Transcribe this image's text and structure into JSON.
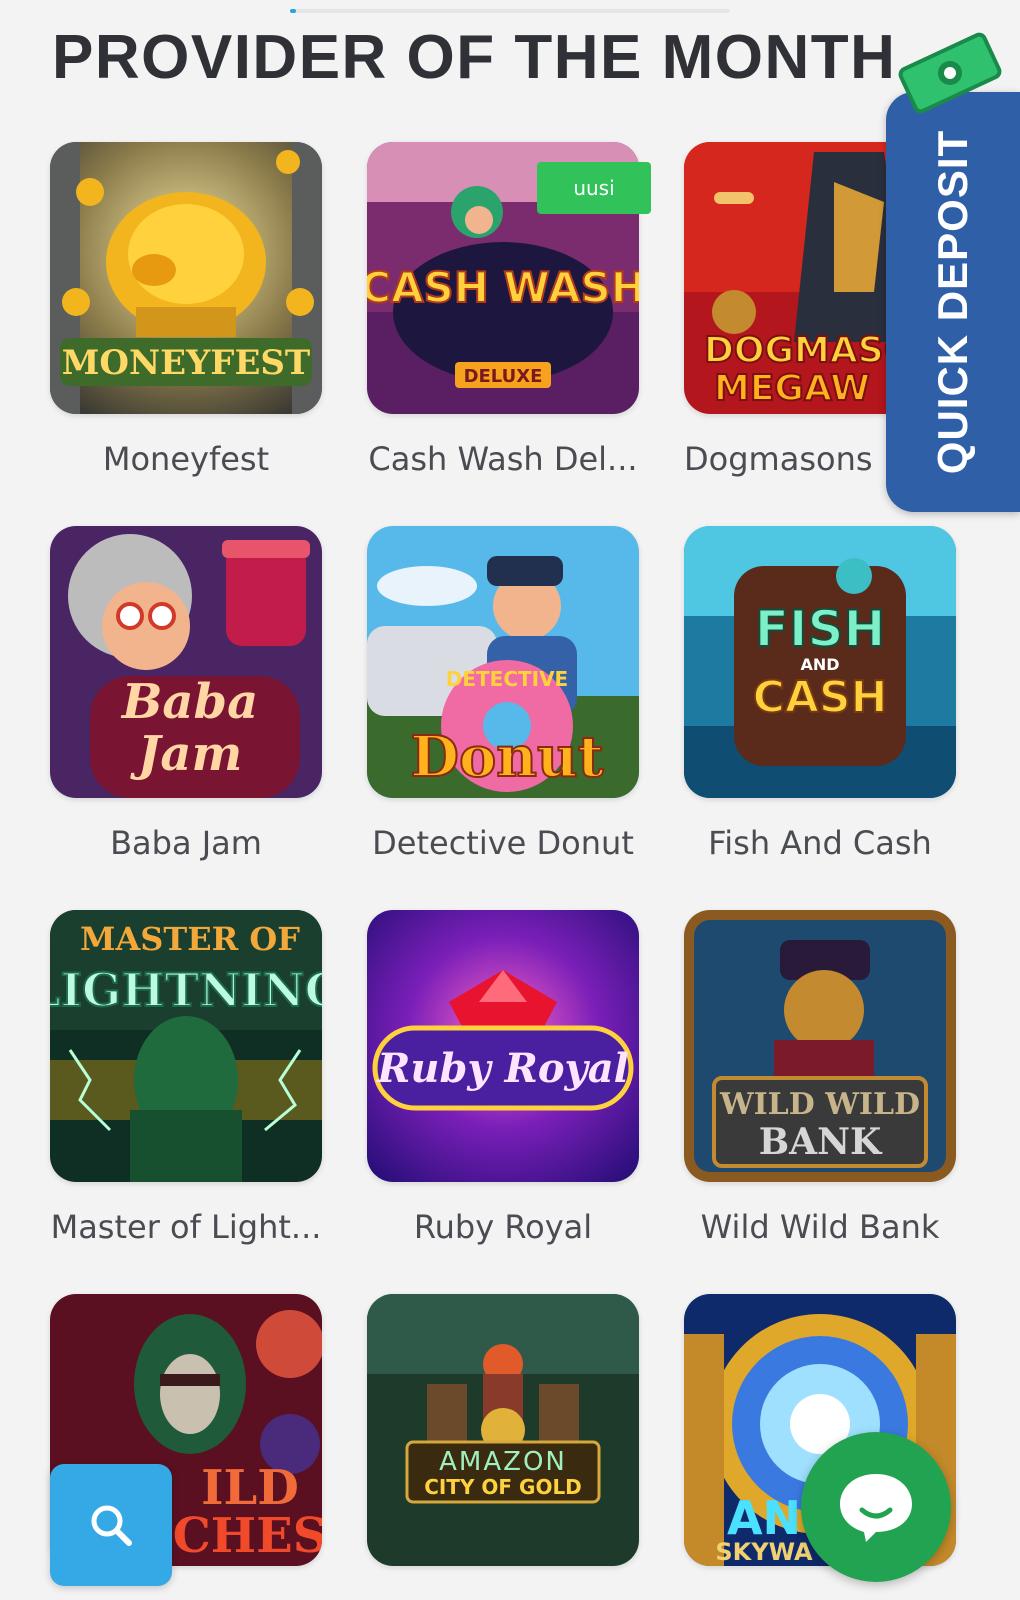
{
  "page": {
    "title": "PROVIDER OF THE MONTH"
  },
  "games": [
    {
      "name": "Moneyfest",
      "art_text": "MONEYFEST",
      "badge": ""
    },
    {
      "name": "Cash Wash Del...",
      "art_text": "CASH WASH",
      "art_sub": "DELUXE",
      "badge": "uusi"
    },
    {
      "name": "Dogmasons",
      "art_text": "DOGMASO",
      "art_sub": "MEGAW",
      "badge": ""
    },
    {
      "name": "Baba Jam",
      "art_text": "Baba",
      "art_sub": "Jam",
      "badge": ""
    },
    {
      "name": "Detective Donut",
      "art_text": "Donut",
      "art_sub": "DETECTIVE",
      "badge": ""
    },
    {
      "name": "Fish And Cash",
      "art_text": "FISH",
      "art_mid": "AND",
      "art_sub": "CASH",
      "badge": ""
    },
    {
      "name": "Master of Light...",
      "art_text": "MASTER OF",
      "art_sub": "LIGHTNING",
      "badge": ""
    },
    {
      "name": "Ruby Royal",
      "art_text": "Ruby Royal",
      "badge": ""
    },
    {
      "name": "Wild Wild Bank",
      "art_text": "WILD WILD",
      "art_sub": "BANK",
      "badge": ""
    },
    {
      "name": "",
      "art_text": "ILD",
      "art_sub": "CHES",
      "badge": ""
    },
    {
      "name": "",
      "art_text": "AMAZON",
      "art_sub": "CITY OF GOLD",
      "badge": ""
    },
    {
      "name": "",
      "art_text": "AN",
      "art_sub": "SKYWA",
      "badge": ""
    }
  ],
  "quick_deposit": {
    "label": "QUICK DEPOSIT",
    "icon": "money-icon"
  },
  "search": {
    "icon": "search-icon"
  },
  "chat": {
    "icon": "chat-icon"
  },
  "colors": {
    "accent": "#2aa4d8",
    "deposit": "#2f5fa7",
    "badge": "#31c25a",
    "chat": "#22a352",
    "search": "#35a9e6"
  }
}
